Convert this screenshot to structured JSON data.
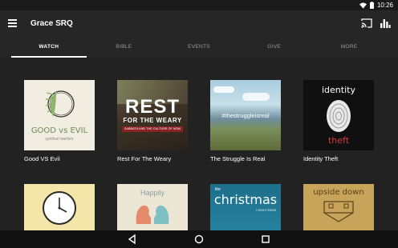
{
  "status": {
    "time": "10:26"
  },
  "app": {
    "title": "Grace SRQ"
  },
  "tabs": [
    "WATCH",
    "BIBLE",
    "EVENTS",
    "GIVE",
    "MORE"
  ],
  "cards": [
    {
      "title": "Good VS Evil",
      "thumb_big": "GOOD vs EVIL",
      "thumb_small": "spiritual warfare"
    },
    {
      "title": "Rest For The Weary",
      "thumb_big": "REST",
      "thumb_mid": "FOR THE WEARY",
      "thumb_small": "SABBATH AND THE CULTURE OF NOW"
    },
    {
      "title": "The Struggle Is Real",
      "thumb_big": "#thestruggleisreal"
    },
    {
      "title": "Identity Theft",
      "thumb_top": "identity",
      "thumb_bottom": "theft"
    },
    {
      "title": "",
      "thumb": "clock"
    },
    {
      "title": "",
      "thumb_big": "Happily"
    },
    {
      "title": "",
      "thumb_top": "the",
      "thumb_big": "christmas",
      "thumb_small": "i never knew"
    },
    {
      "title": "",
      "thumb_big": "upside down"
    }
  ],
  "colors": {
    "background": "#222222",
    "bars": "#262626",
    "navbar": "#111111"
  }
}
